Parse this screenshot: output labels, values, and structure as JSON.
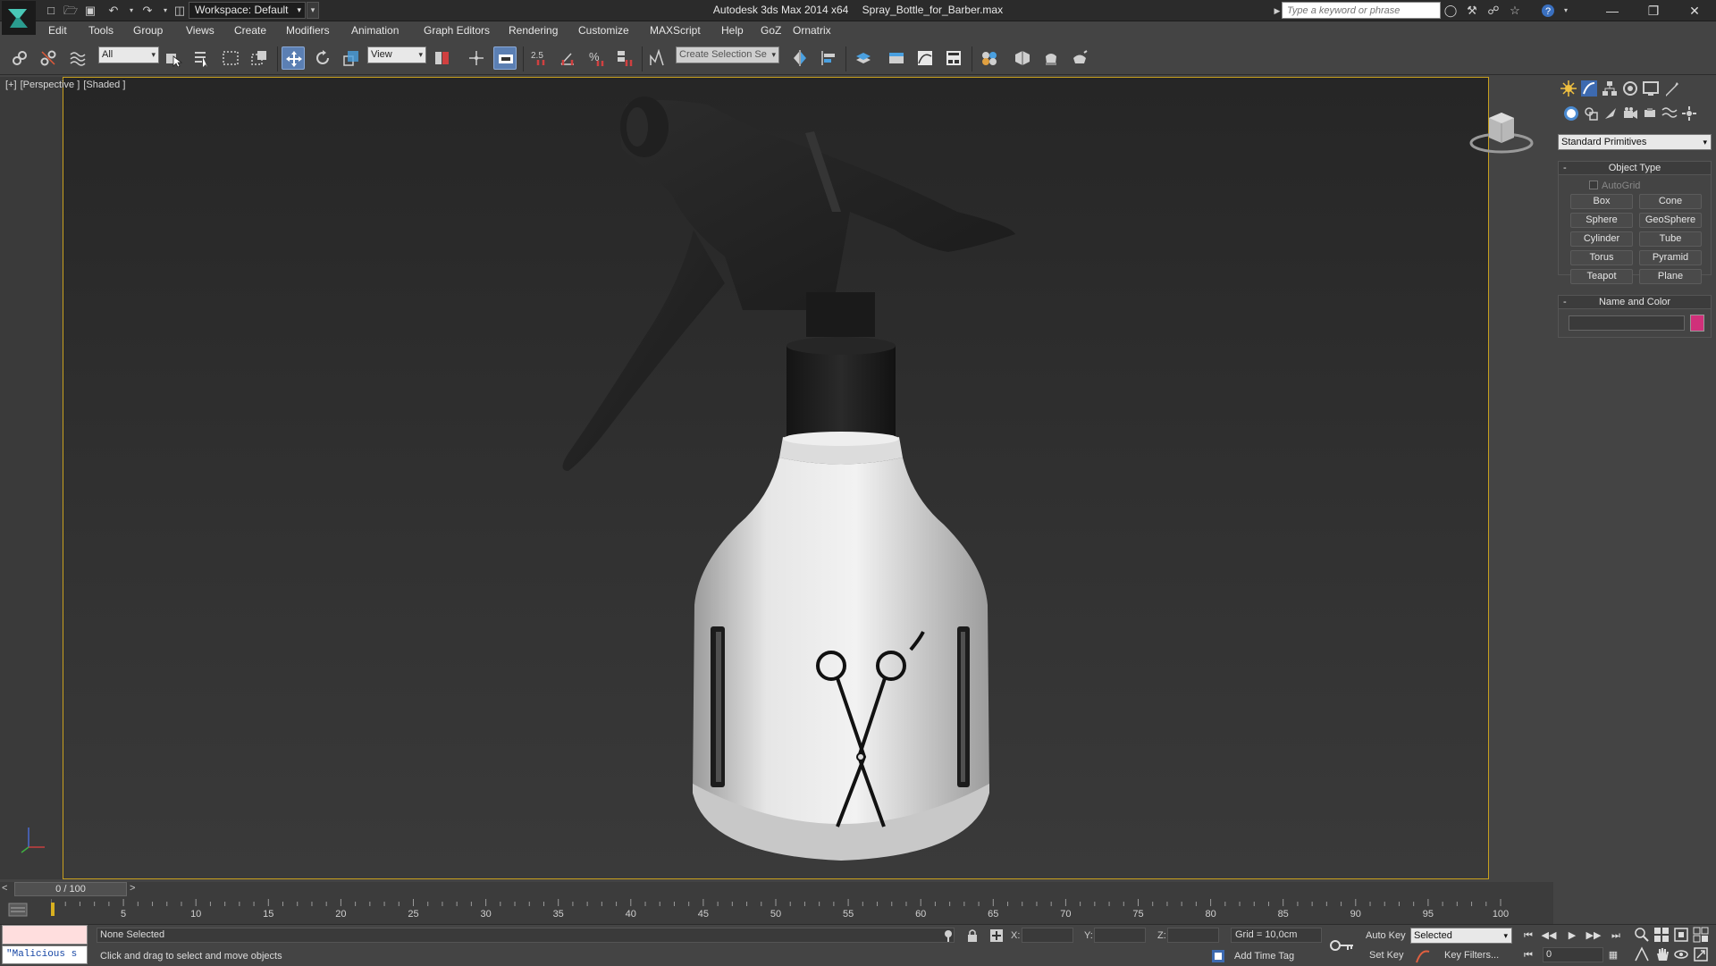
{
  "title_bar": {
    "app_name": "Autodesk 3ds Max  2014 x64",
    "file_name": "Spray_Bottle_for_Barber.max",
    "workspace": "Workspace: Default",
    "search_placeholder": "Type a keyword or phrase"
  },
  "menu": [
    "Edit",
    "Tools",
    "Group",
    "Views",
    "Create",
    "Modifiers",
    "Animation",
    "Graph Editors",
    "Rendering",
    "Customize",
    "MAXScript",
    "Help",
    "GoZ",
    "Ornatrix"
  ],
  "toolbar": {
    "selection_filter": "All",
    "reference_coord": "View",
    "snap_value": "2.5",
    "named_selection_placeholder": "Create Selection Se"
  },
  "viewport": {
    "label_parts": [
      "[+]",
      "[Perspective ]",
      "[Shaded ]"
    ],
    "model": "spray bottle with scissors decal",
    "viewcube_face": "FRONT",
    "border_color": "#c8a01e"
  },
  "command_panel": {
    "category": "Standard Primitives",
    "object_type_title": "Object Type",
    "autogrid_label": "AutoGrid",
    "buttons": [
      "Box",
      "Cone",
      "Sphere",
      "GeoSphere",
      "Cylinder",
      "Tube",
      "Torus",
      "Pyramid",
      "Teapot",
      "Plane"
    ],
    "name_and_color_title": "Name and Color",
    "swatch_color": "#d0307a"
  },
  "timeline": {
    "frame_readout": "0 / 100",
    "prev_arrow": "<",
    "next_arrow": ">",
    "ticks": [
      "5",
      "10",
      "15",
      "20",
      "25",
      "30",
      "35",
      "40",
      "45",
      "50",
      "55",
      "60",
      "65",
      "70",
      "75",
      "80",
      "85",
      "90",
      "95",
      "100"
    ]
  },
  "status": {
    "selection": "None Selected",
    "prompt": "Click and drag to select and move objects",
    "script_text": "\"Malicious s",
    "x_label": "X:",
    "y_label": "Y:",
    "z_label": "Z:",
    "grid": "Grid = 10,0cm",
    "add_time_tag": "Add Time Tag",
    "auto_key": "Auto Key",
    "set_key": "Set Key",
    "key_mode": "Selected",
    "key_filters": "Key Filters...",
    "current_frame": "0"
  }
}
